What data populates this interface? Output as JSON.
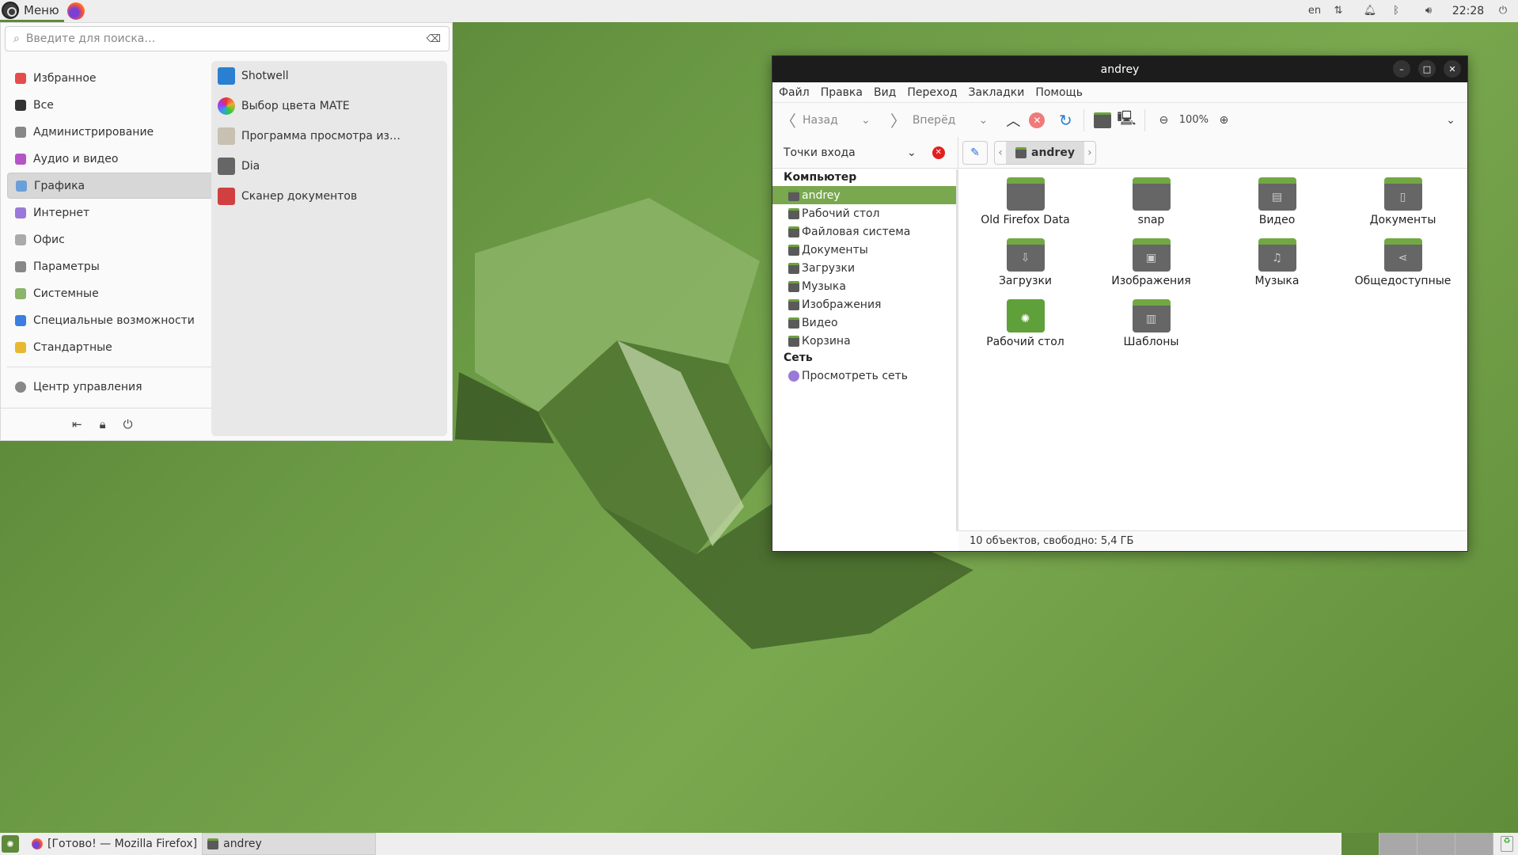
{
  "top_panel": {
    "menu_label": "Меню",
    "tray": {
      "lang": "en",
      "clock": "22:28"
    }
  },
  "menu": {
    "search_placeholder": "Введите для поиска…",
    "categories": [
      {
        "label": "Избранное",
        "color": "#e74c4c"
      },
      {
        "label": "Все",
        "color": "#333333"
      },
      {
        "label": "Администрирование",
        "color": "#888888"
      },
      {
        "label": "Аудио и видео",
        "color": "#b455c8"
      },
      {
        "label": "Графика",
        "color": "#6aa0d8"
      },
      {
        "label": "Интернет",
        "color": "#9a7ad8"
      },
      {
        "label": "Офис",
        "color": "#aaaaaa"
      },
      {
        "label": "Параметры",
        "color": "#888888"
      },
      {
        "label": "Системные",
        "color": "#8bb56a"
      },
      {
        "label": "Специальные возможности",
        "color": "#3b7de0"
      },
      {
        "label": "Стандартные",
        "color": "#e8b830"
      }
    ],
    "selected_category": "Графика",
    "control_center": "Центр управления",
    "apps": [
      {
        "label": "Shotwell",
        "color": "#2a7fd0"
      },
      {
        "label": "Выбор цвета MATE",
        "color": "#e05050"
      },
      {
        "label": "Программа просмотра из…",
        "color": "#c8c0b0"
      },
      {
        "label": "Dia",
        "color": "#666666"
      },
      {
        "label": "Сканер документов",
        "color": "#d04040"
      }
    ]
  },
  "file_manager": {
    "title": "andrey",
    "menubar": [
      "Файл",
      "Правка",
      "Вид",
      "Переход",
      "Закладки",
      "Помощь"
    ],
    "toolbar": {
      "back": "Назад",
      "forward": "Вперёд",
      "zoom": "100%"
    },
    "places_label": "Точки входа",
    "path": "andrey",
    "sidebar": {
      "computer_header": "Компьютер",
      "computer": [
        "andrey",
        "Рабочий стол",
        "Файловая система",
        "Документы",
        "Загрузки",
        "Музыка",
        "Изображения",
        "Видео",
        "Корзина"
      ],
      "network_header": "Сеть",
      "network": [
        "Просмотреть сеть"
      ]
    },
    "items": [
      {
        "name": "Old Firefox Data",
        "glyph": ""
      },
      {
        "name": "snap",
        "glyph": ""
      },
      {
        "name": "Видео",
        "glyph": "▤"
      },
      {
        "name": "Документы",
        "glyph": "▯"
      },
      {
        "name": "Загрузки",
        "glyph": "⇩"
      },
      {
        "name": "Изображения",
        "glyph": "▣"
      },
      {
        "name": "Музыка",
        "glyph": "♫"
      },
      {
        "name": "Общедоступные",
        "glyph": "⋖"
      },
      {
        "name": "Рабочий стол",
        "glyph": "✺"
      },
      {
        "name": "Шаблоны",
        "glyph": "▥"
      }
    ],
    "status": "10 объектов, свободно: 5,4 ГБ"
  },
  "bottom_panel": {
    "tasks": [
      "[Готово! — Mozilla Firefox]",
      "andrey"
    ]
  }
}
